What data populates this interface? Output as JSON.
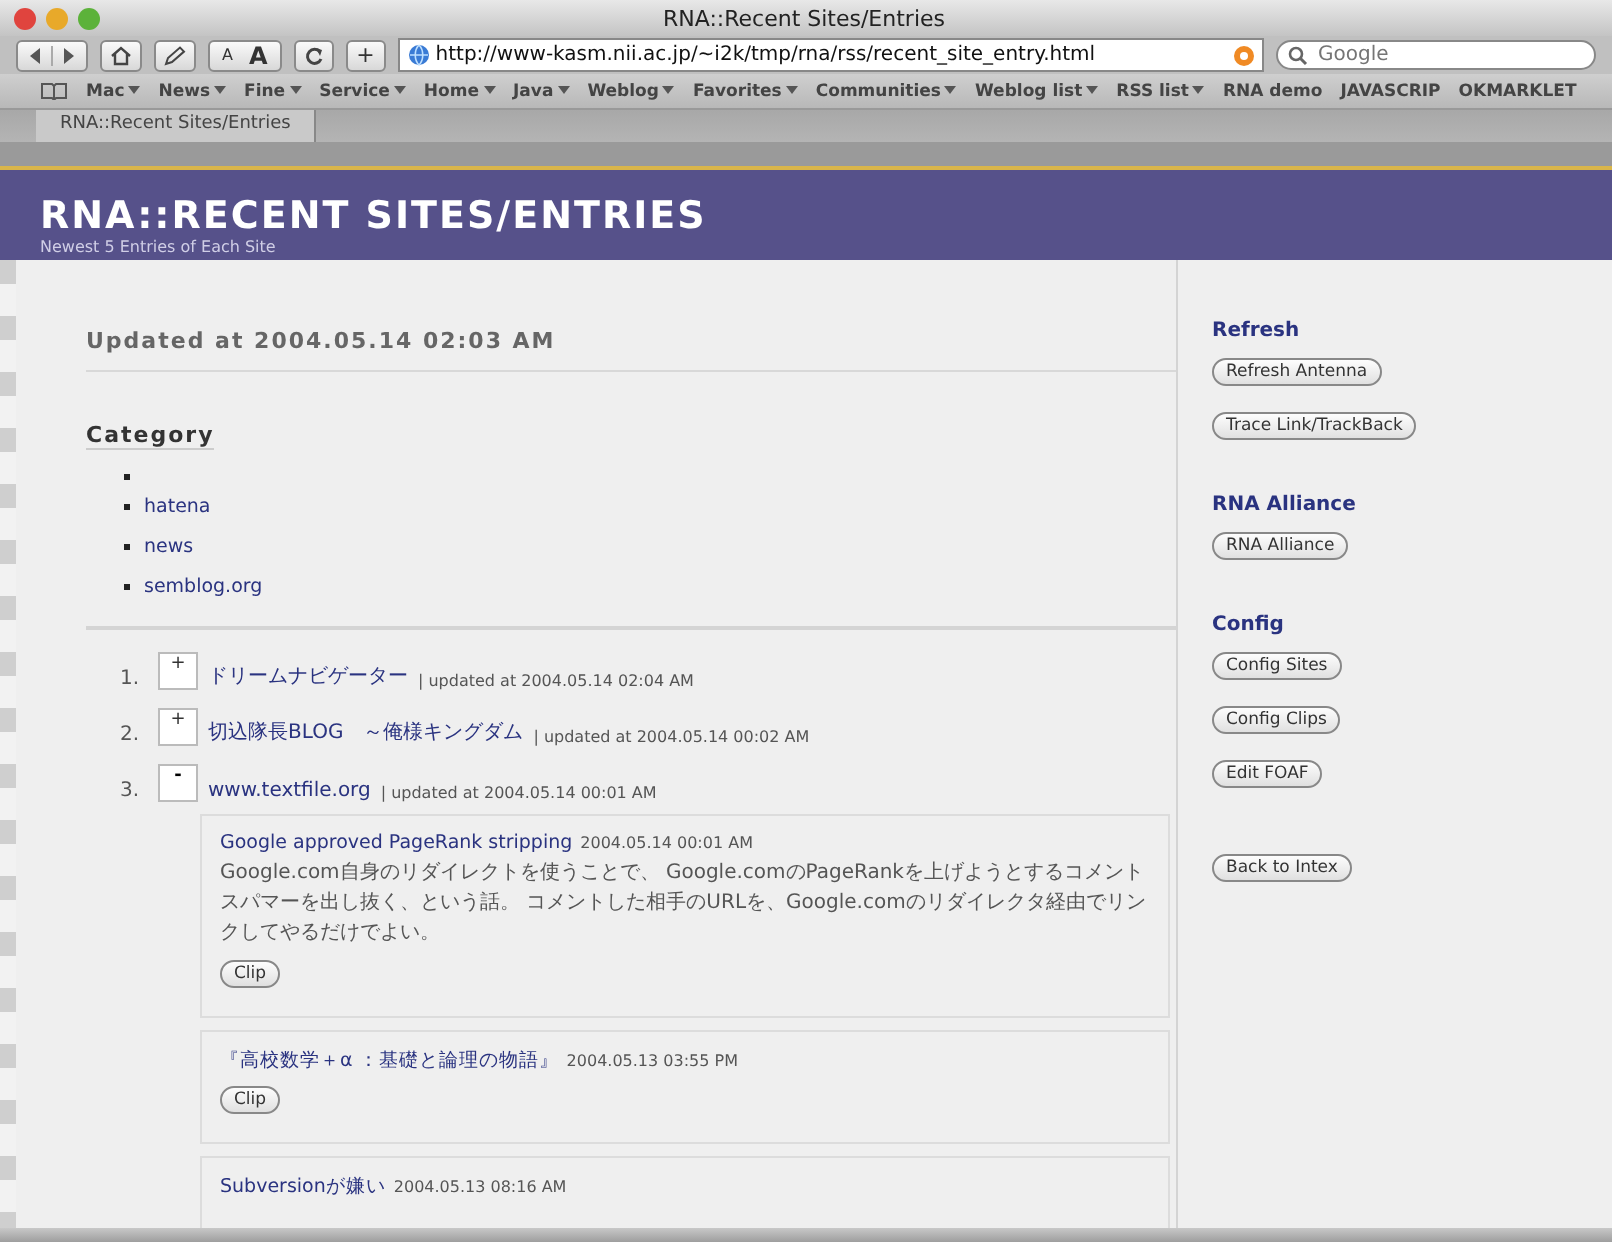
{
  "window": {
    "title": "RNA::Recent Sites/Entries"
  },
  "toolbar": {
    "font_small": "A",
    "font_large": "A",
    "add": "+",
    "url": "http://www-kasm.nii.ac.jp/~i2k/tmp/rna/rss/recent_site_entry.html",
    "search": {
      "placeholder": "Google"
    }
  },
  "bookmarks": [
    {
      "label": "Mac",
      "menu": true
    },
    {
      "label": "News",
      "menu": true
    },
    {
      "label": "Fine",
      "menu": true
    },
    {
      "label": "Service",
      "menu": true
    },
    {
      "label": "Home",
      "menu": true
    },
    {
      "label": "Java",
      "menu": true
    },
    {
      "label": "Weblog",
      "menu": true
    },
    {
      "label": "Favorites",
      "menu": true
    },
    {
      "label": "Communities",
      "menu": true
    },
    {
      "label": "Weblog list",
      "menu": true
    },
    {
      "label": "RSS list",
      "menu": true
    },
    {
      "label": "RNA demo",
      "menu": false
    },
    {
      "label": "JAVASCRIP",
      "menu": false
    },
    {
      "label": "OKMARKLET",
      "menu": false
    }
  ],
  "tabs": [
    {
      "label": "RNA::Recent Sites/Entries",
      "selected": true
    }
  ],
  "header": {
    "title": "RNA::RECENT SITES/ENTRIES",
    "subtitle": "Newest 5 Entries of Each Site"
  },
  "updated": "Updated at 2004.05.14 02:03 AM",
  "category": {
    "heading": "Category",
    "items": [
      {
        "kind": "blank"
      },
      {
        "kind": "link",
        "label": "hatena"
      },
      {
        "kind": "link",
        "label": "news"
      },
      {
        "kind": "link",
        "label": "semblog.org"
      }
    ]
  },
  "sites": [
    {
      "number": "1.",
      "toggle": "+",
      "expanded": false,
      "name": "ドリームナビゲーター",
      "updated": "| updated at 2004.05.14 02:04 AM"
    },
    {
      "number": "2.",
      "toggle": "+",
      "expanded": false,
      "name": "切込隊長BLOG　～俺様キングダム",
      "updated": "| updated at 2004.05.14 00:02 AM"
    },
    {
      "number": "3.",
      "toggle": "-",
      "expanded": true,
      "name": "www.textfile.org",
      "updated": "| updated at 2004.05.14 00:01 AM",
      "entries": [
        {
          "title": "Google approved PageRank stripping",
          "date": "2004.05.14 00:01 AM",
          "body": "Google.com自身のリダイレクトを使うことで、 Google.comのPageRankを上げようとするコメントスパマーを出し抜く、という話。 コメントした相手のURLを、Google.comのリダイレクタ経由でリンクしてやるだけでよい。",
          "button": "Clip"
        },
        {
          "title": "『高校数学＋α ：基礎と論理の物語』",
          "date": "2004.05.13 03:55 PM",
          "button": "Clip"
        },
        {
          "title": "Subversionが嫌い",
          "date": "2004.05.13 08:16 AM"
        }
      ]
    }
  ],
  "sidebar": [
    {
      "heading": "Refresh",
      "buttons": [
        "Refresh Antenna",
        "Trace Link/TrackBack"
      ]
    },
    {
      "heading": "RNA Alliance",
      "buttons": [
        "RNA Alliance"
      ]
    },
    {
      "heading": "Config",
      "buttons": [
        "Config Sites",
        "Config Clips",
        "Edit FOAF"
      ]
    },
    {
      "buttons": [
        "Back to Intex"
      ]
    }
  ]
}
